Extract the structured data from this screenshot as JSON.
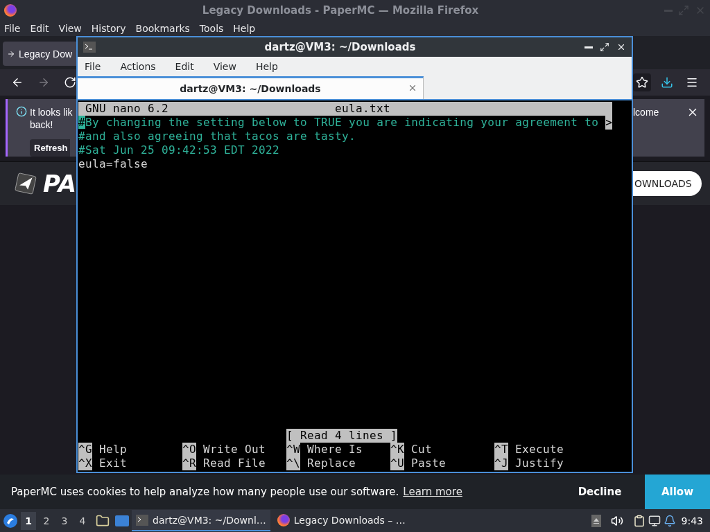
{
  "browser": {
    "title": "Legacy Downloads - PaperMC — Mozilla Firefox",
    "menu": [
      {
        "label": "File"
      },
      {
        "label": "Edit"
      },
      {
        "label": "View"
      },
      {
        "label": "History"
      },
      {
        "label": "Bookmarks"
      },
      {
        "label": "Tools"
      },
      {
        "label": "Help"
      }
    ],
    "tab": {
      "title": "Legacy Dow",
      "selected": true
    },
    "notification": {
      "text_left": "It looks lik",
      "text_left_line2": "back!",
      "text_right": "lcome",
      "button": "Refresh"
    },
    "site": {
      "logo_text": "PA",
      "button": "OWNLOADS"
    },
    "cookie_bar": {
      "text": "PaperMC uses cookies to help analyze how many people use our software.",
      "link": "Learn more",
      "buttons": [
        {
          "label": "Decline",
          "kind": "plain"
        },
        {
          "label": "Allow",
          "kind": "primary"
        }
      ]
    }
  },
  "terminal": {
    "title": "dartz@VM3: ~/Downloads",
    "menu": [
      {
        "label": "File"
      },
      {
        "label": "Actions"
      },
      {
        "label": "Edit"
      },
      {
        "label": "View"
      },
      {
        "label": "Help"
      }
    ],
    "tabs": [
      {
        "title": "dartz@VM3: ~/Downloads",
        "selected": true
      }
    ],
    "nano": {
      "version": "GNU nano 6.2",
      "filename": "eula.txt",
      "lines": [
        {
          "text": "#By changing the setting below to TRUE you are indicating your agreement to",
          "kind": "comment",
          "cursor": true,
          "overflow_mark": ">"
        },
        {
          "text": "#and also agreeing that tacos are tasty.",
          "kind": "comment",
          "cursor": false
        },
        {
          "text": "#Sat Jun 25 09:42:53 EDT 2022",
          "kind": "comment",
          "cursor": false
        },
        {
          "text": "eula=false",
          "kind": "plain",
          "cursor": false
        }
      ],
      "status": "[ Read 4 lines ]",
      "shortcuts": [
        {
          "key": "^G",
          "label": "Help"
        },
        {
          "key": "^O",
          "label": "Write Out"
        },
        {
          "key": "^W",
          "label": "Where Is"
        },
        {
          "key": "^K",
          "label": "Cut"
        },
        {
          "key": "^T",
          "label": "Execute"
        },
        {
          "key": "^X",
          "label": "Exit"
        },
        {
          "key": "^R",
          "label": "Read File"
        },
        {
          "key": "^\\",
          "label": "Replace"
        },
        {
          "key": "^U",
          "label": "Paste"
        },
        {
          "key": "^J",
          "label": "Justify"
        }
      ]
    }
  },
  "taskbar": {
    "workspaces": [
      {
        "label": "1",
        "selected": true
      },
      {
        "label": "2",
        "selected": false
      },
      {
        "label": "3",
        "selected": false
      },
      {
        "label": "4",
        "selected": false
      }
    ],
    "tasks": [
      {
        "title": "dartz@VM3: ~/Downl…",
        "kind": "terminal",
        "selected": true
      },
      {
        "title": "Legacy Downloads – …",
        "kind": "browser",
        "selected": false
      }
    ],
    "clock": "9:43"
  }
}
